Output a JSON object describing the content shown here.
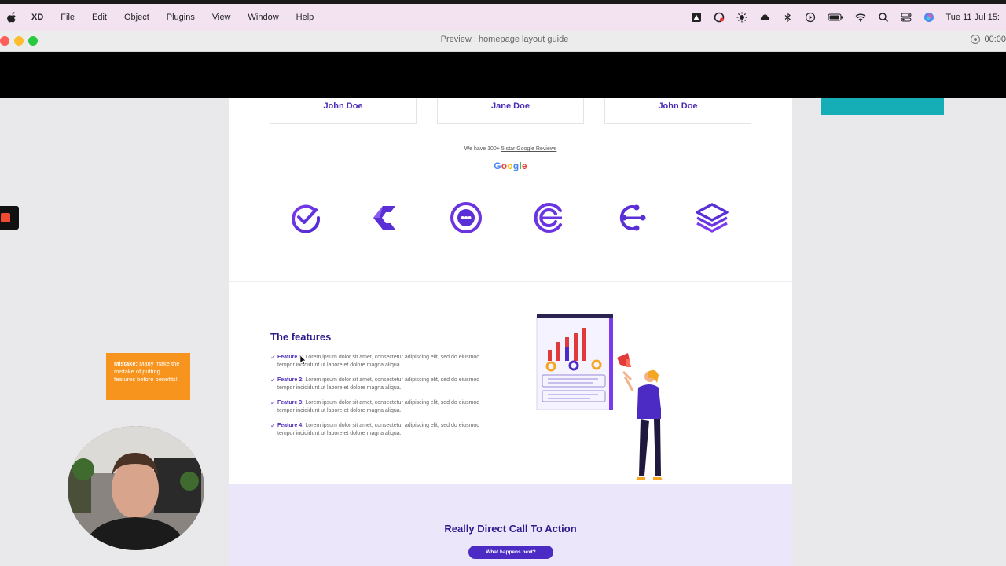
{
  "menubar": {
    "app_name": "XD",
    "items": [
      "File",
      "Edit",
      "Object",
      "Plugins",
      "View",
      "Window",
      "Help"
    ],
    "clock": "Tue 11 Jul  15:"
  },
  "window": {
    "title": "Preview : homepage layout guide",
    "recording_time": "00:00"
  },
  "reviews": {
    "cards": [
      "John Doe",
      "Jane Doe",
      "John Doe"
    ],
    "text_prefix": "We have 100+ ",
    "text_link": "5 star Google Reviews",
    "google": {
      "letters": [
        "G",
        "o",
        "o",
        "g",
        "l",
        "e"
      ],
      "colors": [
        "#4285F4",
        "#EA4335",
        "#FBBC05",
        "#4285F4",
        "#34A853",
        "#EA4335"
      ]
    }
  },
  "logos": [
    "check-circle-logo",
    "chevron-c-logo",
    "target-dots-logo",
    "circle-c-logo",
    "node-c-logo",
    "stacked-layers-logo"
  ],
  "features": {
    "title": "The features",
    "items": [
      {
        "label": "Feature 1:",
        "text": " Lorem ipsum dolor sit amet, consectetur adipiscing elit, sed do eiusmod tempor incididunt ut labore et dolore magna aliqua."
      },
      {
        "label": "Feature 2:",
        "text": " Lorem ipsum dolor sit amet, consectetur adipiscing elit, sed do eiusmod tempor incididunt ut labore et dolore magna aliqua."
      },
      {
        "label": "Feature 3:",
        "text": " Lorem ipsum dolor sit amet, consectetur adipiscing elit, sed do eiusmod tempor incididunt ut labore et dolore magna aliqua."
      },
      {
        "label": "Feature 4:",
        "text": " Lorem ipsum dolor sit amet, consectetur adipiscing elit, sed do eiusmod tempor incididunt ut labore et dolore magna aliqua."
      }
    ]
  },
  "cta": {
    "title": "Really Direct Call To Action",
    "button": "What happens next?"
  },
  "annotation": {
    "label": "Mistake:",
    "text": " Many make the mistake of putting features before benefits!"
  },
  "colors": {
    "brand_purple": "#4b2bb8",
    "dark_purple": "#2e1a8c",
    "cta_bg": "#ece6fb",
    "sticky": "#f7941d",
    "teal": "#15aeb6"
  }
}
